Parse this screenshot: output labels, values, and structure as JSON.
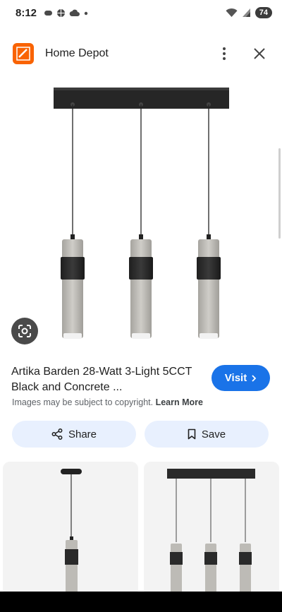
{
  "status_bar": {
    "time": "8:12",
    "battery_level": "74",
    "icons": [
      "notification-icon",
      "sports-icon",
      "cloud-icon",
      "dot-icon",
      "wifi-icon",
      "signal-icon"
    ]
  },
  "header": {
    "source_name": "Home Depot",
    "logo_icon": "home-depot-logo",
    "brand_color": "#f96302"
  },
  "product": {
    "title": "Artika Barden 28-Watt 3-Light 5CCT Black and Concrete ...",
    "visit_label": "Visit",
    "copyright_text": "Images may be subject to copyright.",
    "learn_more_label": "Learn More"
  },
  "actions": {
    "share_label": "Share",
    "save_label": "Save"
  },
  "colors": {
    "accent": "#1a73e8",
    "pill_background": "#e8f0fe"
  }
}
